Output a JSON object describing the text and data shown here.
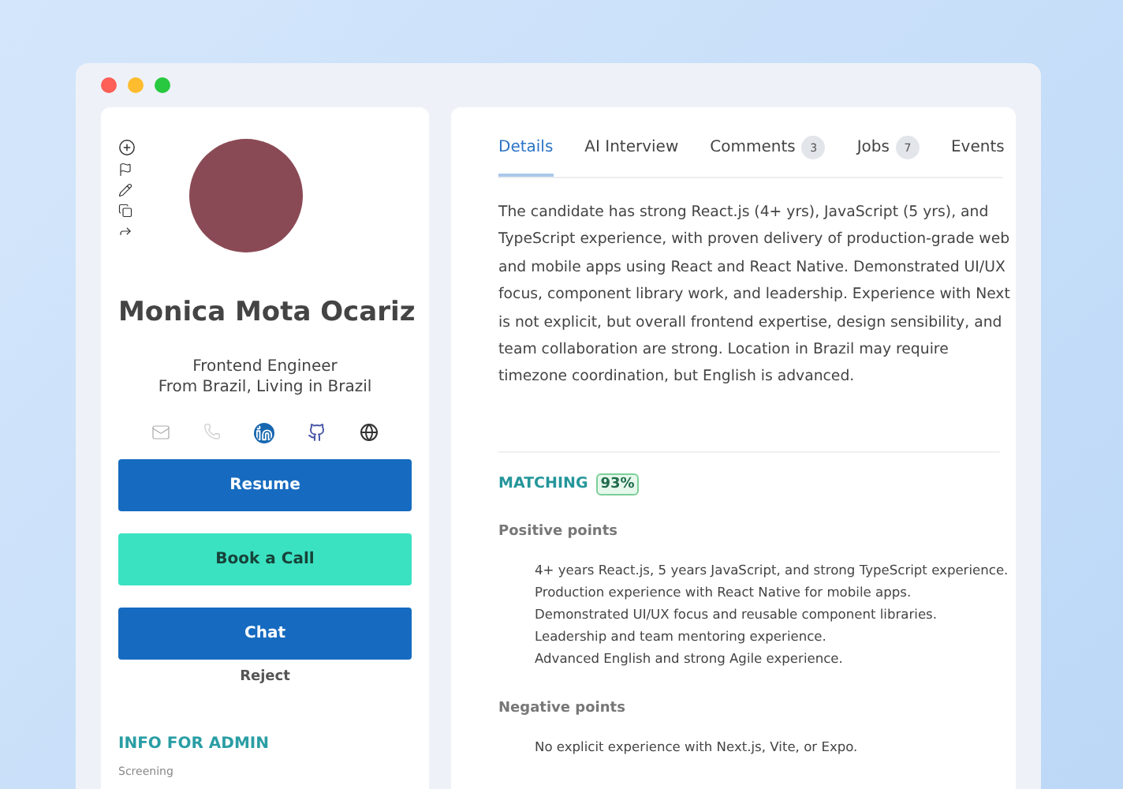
{
  "candidate": {
    "name": "Monica Mota Ocariz",
    "role": "Frontend Engineer",
    "location": "From Brazil, Living in Brazil"
  },
  "actions": [
    {
      "kind": "primary",
      "label": "Resume"
    },
    {
      "kind": "accent",
      "label": "Book a Call"
    },
    {
      "kind": "primary",
      "label": "Chat"
    },
    {
      "kind": "link",
      "label": "Reject"
    }
  ],
  "admin": {
    "heading": "INFO FOR ADMIN",
    "field_label": "Screening"
  },
  "tabs": [
    {
      "label": "Details",
      "selected": true
    },
    {
      "label": "AI Interview",
      "selected": false
    },
    {
      "label": "Comments",
      "count": "3",
      "selected": false
    },
    {
      "label": "Jobs",
      "count": "7",
      "selected": false
    },
    {
      "label": "Events",
      "selected": false
    }
  ],
  "summary": "The candidate has strong React.js (4+ yrs), JavaScript (5 yrs), and TypeScript experience, with proven delivery of production-grade web and mobile apps using React and React Native. Demonstrated UI/UX focus, component library work, and leadership. Experience with Next is not explicit, but overall frontend expertise, design sensibility, and team collaboration are strong. Location in Brazil may require timezone coordination, but English is advanced.",
  "matching": {
    "label": "MATCHING",
    "score": "93%"
  },
  "positive": {
    "title": "Positive points",
    "items": [
      "4+ years React.js, 5 years JavaScript, and strong TypeScript experience.",
      "Production experience with React Native for mobile apps.",
      "Demonstrated UI/UX focus and reusable component libraries.",
      "Leadership and team mentoring experience.",
      "Advanced English and strong Agile experience."
    ]
  },
  "negative": {
    "title": "Negative points",
    "items": [
      "No explicit experience with Next.js, Vite, or Expo."
    ]
  }
}
